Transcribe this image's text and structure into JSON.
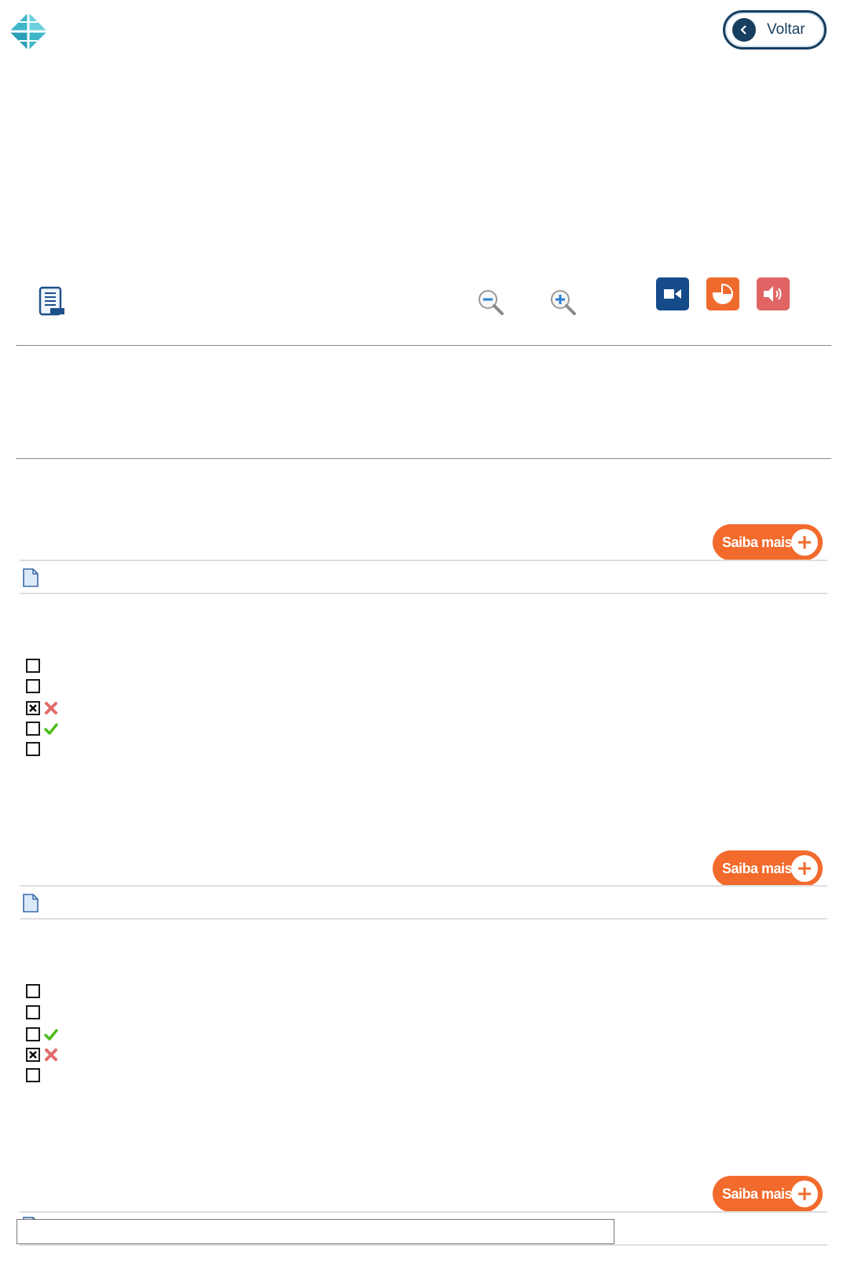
{
  "header": {
    "logo_icon": "diamond-grid-logo",
    "back_button_label": "Voltar",
    "back_icon": "chevron-left-icon",
    "brand_color": "#163e5f"
  },
  "toolbar": {
    "items": [
      {
        "name": "index-list",
        "icon": "list-document-icon"
      },
      {
        "name": "zoom-out",
        "icon": "zoom-out-icon"
      },
      {
        "name": "zoom-in",
        "icon": "zoom-in-icon"
      },
      {
        "name": "video",
        "icon": "video-camera-icon",
        "color": "#164b8a"
      },
      {
        "name": "chart",
        "icon": "pie-chart-icon",
        "color": "#ef6a2d"
      },
      {
        "name": "audio",
        "icon": "speaker-icon",
        "color": "#e06464"
      }
    ]
  },
  "questions": [
    {
      "saiba_mais_label": "Saiba mais",
      "options": [
        {
          "checked": false,
          "result": null
        },
        {
          "checked": false,
          "result": null
        },
        {
          "checked": true,
          "result": "wrong"
        },
        {
          "checked": false,
          "result": "correct"
        },
        {
          "checked": false,
          "result": null
        }
      ]
    },
    {
      "saiba_mais_label": "Saiba mais",
      "options": [
        {
          "checked": false,
          "result": null
        },
        {
          "checked": false,
          "result": null
        },
        {
          "checked": false,
          "result": "correct"
        },
        {
          "checked": true,
          "result": "wrong"
        },
        {
          "checked": false,
          "result": null
        }
      ]
    },
    {
      "saiba_mais_label": "Saiba mais"
    }
  ],
  "accent_color": "#f26a2c",
  "bottom_input": {
    "value": "",
    "placeholder": ""
  }
}
